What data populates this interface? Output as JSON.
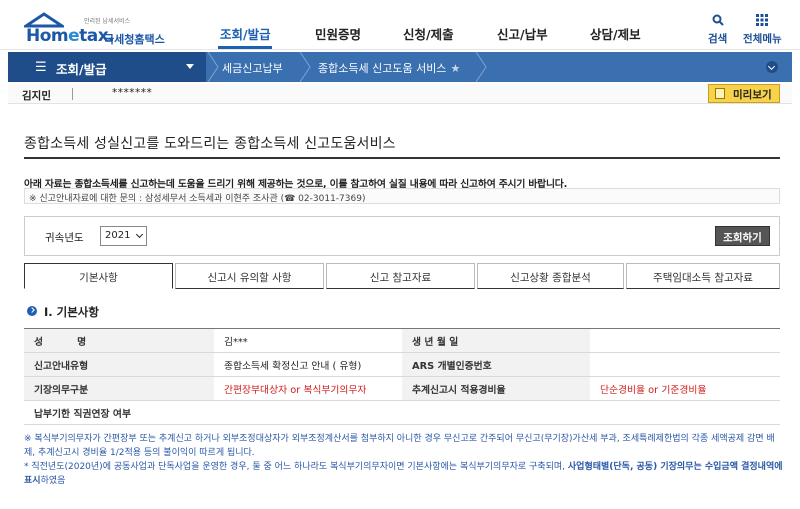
{
  "header": {
    "logo_main_pre": "Hom",
    "logo_main_e": "e",
    "logo_main_post": "tax.",
    "logo_small": "안리된 납세서비스",
    "logo_kr": "국세청홈택스",
    "gnb": [
      "조회/발급",
      "민원증명",
      "신청/제출",
      "신고/납부",
      "상담/제보"
    ],
    "search_label": "검색",
    "allmenu_label": "전체메뉴"
  },
  "navbar": {
    "menu": "조회/발급",
    "crumbs": [
      "세금신고납부",
      "종합소득세 신고도움 서비스"
    ]
  },
  "user": {
    "name": "김지민",
    "id_masked": "*******",
    "preview_button": "미리보기"
  },
  "page": {
    "title": "종합소득세 성실신고를 도와드리는 종합소득세 신고도움서비스",
    "notice": "아래 자료는 종합소득세를 신고하는데 도움을 드리기 위해 제공하는 것으로, 이를 참고하여 실질 내용에 따라 신고하여 주시기 바랍니다.",
    "contact": "※ 신고안내자료에 대한 문의 : 삼성세무서 소득세과 이현주 조사관 (☎ 02-3011-7369)"
  },
  "search": {
    "year_label": "귀속년도",
    "year_value": "2021",
    "button": "조회하기"
  },
  "tabs": [
    "기본사항",
    "신고시 유의할 사항",
    "신고 참고자료",
    "신고상황 종합분석",
    "주택임대소득 참고자료"
  ],
  "section": {
    "title": "Ⅰ. 기본사항"
  },
  "info": {
    "name_label": "성          명",
    "name_value": "김***",
    "birth_label": "생 년 월 일",
    "birth_value": "",
    "guide_type_label": "신고안내유형",
    "guide_type_value": "종합소득세 확정신고 안내 (  유형)",
    "ars_label": "ARS 개별인증번호",
    "ars_value": "",
    "bookkeeping_label": "기장의무구분",
    "bookkeeping_value": "간편장부대상자 or 복식부기의무자",
    "rate_label": "추계신고시 적용경비율",
    "rate_value": "단순경비율 or 기준경비율",
    "extension_label": "납부기한 직권연장 여부",
    "extension_value": ""
  },
  "footnotes": {
    "note1": "※ 복식부기의무자가 간편장부 또는 추계신고 하거나 외부조정대상자가 외부조정계산서를 첨부하지 아니한 경우 무신고로 간주되어 무신고(무기장)가산세 부과, 조세특례제한법의 각종 세액공제 감면 배제, 추계신고시 경비율 1/2적용 등의 불이익이 따르게 됩니다.",
    "note2_pre": "* 직전년도(2020년)에 공동사업과 단독사업을 운영한 경우, 둘 중 어느 하나라도 복식부기의무자이면 기본사항에는 복식부기의무자로 구축되며, ",
    "note2_bold": "사업형태별(단독, 공동) 기장의무는 수입금액 결정내역에 표시",
    "note2_post": "하였음",
    "colors": {
      "accent": "#1c5fb3",
      "navbar": "#3a6fb0",
      "warning": "#d01a1a"
    }
  }
}
